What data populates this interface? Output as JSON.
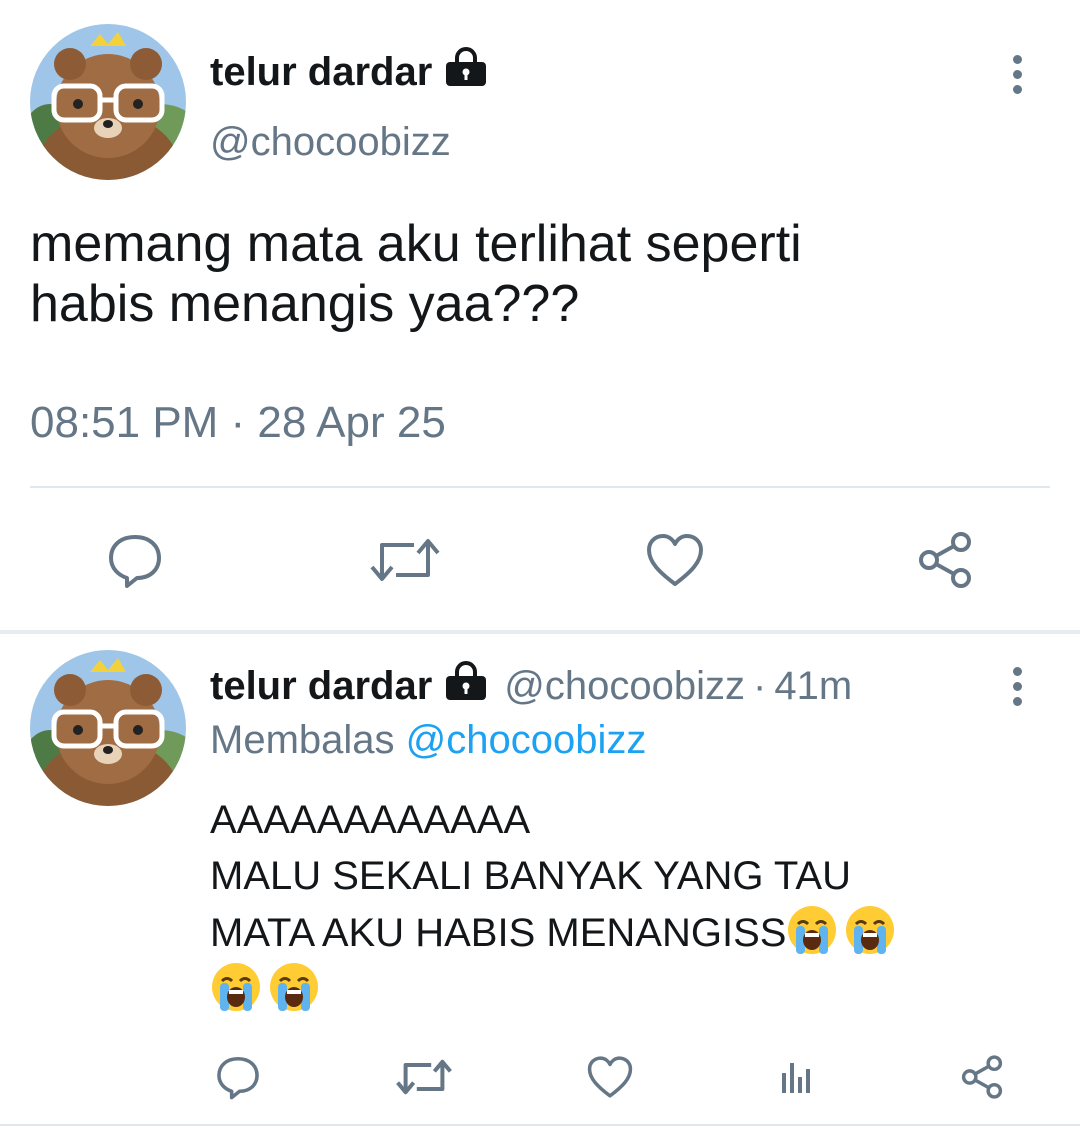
{
  "colors": {
    "text": "#14171a",
    "secondary": "#657786",
    "link": "#1da1f2",
    "divider": "#e1e8ed"
  },
  "main_tweet": {
    "display_name": "telur dardar",
    "handle": "@chocoobizz",
    "protected_icon": "lock-icon",
    "text": "memang mata aku terlihat seperti\nhabis menangis yaa???",
    "timestamp": "08:51 PM · 28 Apr 25",
    "actions": [
      "reply-icon",
      "retweet-icon",
      "like-icon",
      "share-icon"
    ]
  },
  "reply_tweet": {
    "display_name": "telur dardar",
    "handle": "@chocoobizz",
    "separator": "·",
    "time_ago": "41m",
    "replying_label": "Membalas",
    "replying_to": "@chocoobizz",
    "text_lines": [
      "AAAAAAAAAAAA",
      "MALU SEKALI BANYAK YANG TAU",
      "MATA AKU HABIS MENANGISS"
    ],
    "emoji": "loudly-crying-face",
    "emoji_count": 4,
    "actions": [
      "reply-icon",
      "retweet-icon",
      "like-icon",
      "analytics-icon",
      "share-icon"
    ]
  }
}
